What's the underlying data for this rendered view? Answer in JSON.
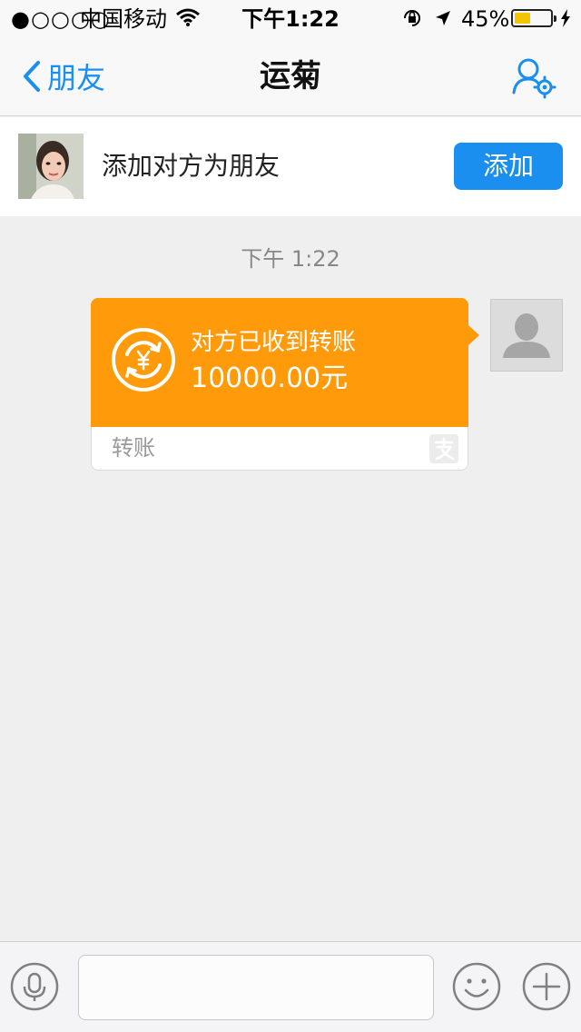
{
  "status_bar": {
    "signal": "●○○○○",
    "carrier": "中国移动",
    "time": "下午1:22",
    "battery_percent": "45%",
    "battery_level": 0.45
  },
  "nav": {
    "back_label": "朋友",
    "title": "运菊"
  },
  "add_friend_bar": {
    "text": "添加对方为朋友",
    "button_label": "添加"
  },
  "chat": {
    "timestamp": "下午 1:22",
    "transfer": {
      "status": "对方已收到转账",
      "amount": "10000.00元",
      "type_label": "转账"
    }
  },
  "input_bar": {
    "placeholder": ""
  },
  "colors": {
    "accent": "#1a8ff0",
    "transfer_orange": "#ff9a0a",
    "background": "#efeff0"
  },
  "icons": [
    "wifi-icon",
    "orientation-lock-icon",
    "location-arrow-icon",
    "charging-bolt-icon",
    "chevron-left-icon",
    "user-settings-icon",
    "yuan-refresh-icon",
    "alipay-icon",
    "default-avatar-icon",
    "microphone-icon",
    "emoji-icon",
    "plus-icon"
  ]
}
